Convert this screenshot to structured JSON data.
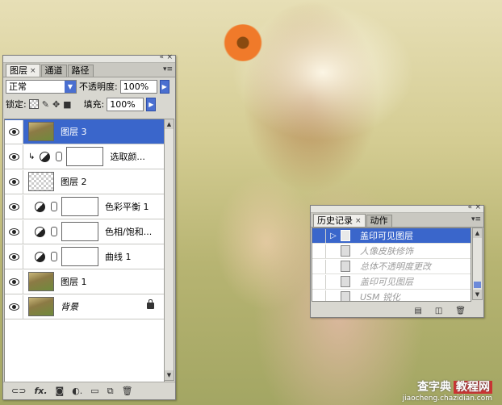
{
  "layers_panel": {
    "tabs": [
      "图层",
      "通道",
      "路径"
    ],
    "blend_mode": "正常",
    "opacity_label": "不透明度:",
    "opacity_value": "100%",
    "lock_label": "锁定:",
    "fill_label": "填充:",
    "fill_value": "100%",
    "layers": [
      {
        "name": "图层 3",
        "selected": true,
        "kind": "photo"
      },
      {
        "name": "选取颜...",
        "selected": false,
        "kind": "adjustment-clipped"
      },
      {
        "name": "图层 2",
        "selected": false,
        "kind": "transparent"
      },
      {
        "name": "色彩平衡 1",
        "selected": false,
        "kind": "adjustment"
      },
      {
        "name": "色相/饱和...",
        "selected": false,
        "kind": "adjustment"
      },
      {
        "name": "曲线 1",
        "selected": false,
        "kind": "adjustment"
      },
      {
        "name": "图层 1",
        "selected": false,
        "kind": "photo"
      },
      {
        "name": "背景",
        "selected": false,
        "kind": "background",
        "locked": true
      }
    ],
    "footer_icons": [
      "link-icon",
      "fx-icon",
      "mask-icon",
      "adjustment-icon",
      "group-icon",
      "new-layer-icon",
      "trash-icon"
    ]
  },
  "history_panel": {
    "tabs": [
      "历史记录",
      "动作"
    ],
    "items": [
      {
        "label": "盖印可见图层",
        "state": "selected"
      },
      {
        "label": "人像皮肤修饰",
        "state": "dim"
      },
      {
        "label": "总体不透明度更改",
        "state": "dim"
      },
      {
        "label": "盖印可见图层",
        "state": "dim"
      },
      {
        "label": "USM 锐化",
        "state": "dim"
      }
    ],
    "footer_icons": [
      "snapshot-icon",
      "camera-icon",
      "trash-icon"
    ]
  },
  "watermark": {
    "line1_a": "查字典",
    "line1_b": "教程网",
    "line2": "jiaocheng.chazidian.com"
  },
  "colors": {
    "selection": "#3a66cb",
    "panel_bg": "#d8d7d0"
  }
}
